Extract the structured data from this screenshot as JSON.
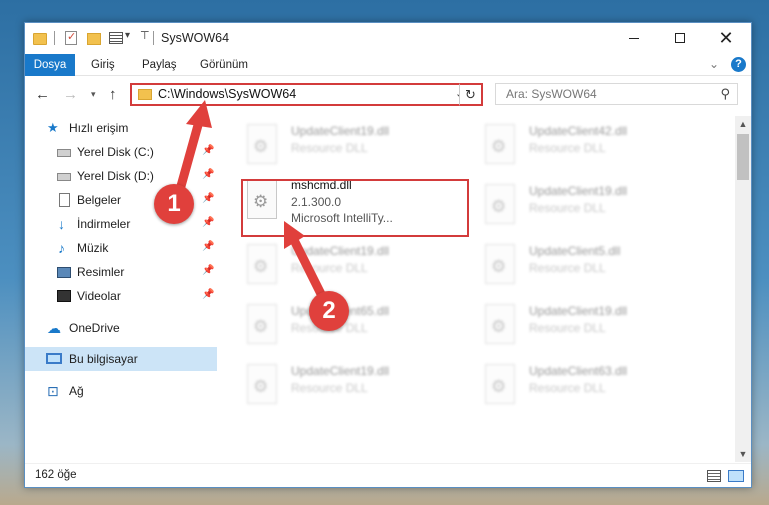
{
  "window": {
    "title": "SysWOW64",
    "controls": {
      "minimize": "minimize",
      "maximize": "maximize",
      "close": "✕"
    }
  },
  "ribbon": {
    "tabs": [
      "Dosya",
      "Giriş",
      "Paylaş",
      "Görünüm"
    ],
    "file_tab_color": "#1979ca"
  },
  "navigation": {
    "address": "C:\\Windows\\SysWOW64",
    "search_placeholder": "Ara: SysWOW64"
  },
  "sidebar": {
    "quick_access": "Hızlı erişim",
    "items": [
      {
        "label": "Yerel Disk (C:)",
        "icon": "drive-icon",
        "pinned": true
      },
      {
        "label": "Yerel Disk (D:)",
        "icon": "drive-icon",
        "pinned": true
      },
      {
        "label": "Belgeler",
        "icon": "documents-icon",
        "pinned": true
      },
      {
        "label": "İndirmeler",
        "icon": "downloads-icon",
        "pinned": true
      },
      {
        "label": "Müzik",
        "icon": "music-icon",
        "pinned": true
      },
      {
        "label": "Resimler",
        "icon": "pictures-icon",
        "pinned": true
      },
      {
        "label": "Videolar",
        "icon": "videos-icon",
        "pinned": true
      }
    ],
    "onedrive": "OneDrive",
    "this_pc": "Bu bilgisayar",
    "network": "Ağ",
    "selected": "Bu bilgisayar"
  },
  "files": {
    "highlighted": {
      "name": "mshcmd.dll",
      "version": "2.1.300.0",
      "company": "Microsoft IntelliTy..."
    },
    "left_column": [
      {
        "name": "UpdateClient19.dll",
        "type": "Resource DLL"
      },
      {
        "name": "UpdateClient19.dll",
        "type": "Resource DLL"
      },
      {
        "name": "UpdateClient65.dll",
        "type": "Resource DLL"
      },
      {
        "name": "UpdateClient19.dll",
        "type": "Resource DLL"
      }
    ],
    "right_column": [
      {
        "name": "UpdateClient42.dll",
        "type": "Resource DLL"
      },
      {
        "name": "UpdateClient19.dll",
        "type": "Resource DLL"
      },
      {
        "name": "UpdateClient5.dll",
        "type": "Resource DLL"
      },
      {
        "name": "UpdateClient19.dll",
        "type": "Resource DLL"
      },
      {
        "name": "UpdateClient63.dll",
        "type": "Resource DLL"
      }
    ]
  },
  "status": {
    "item_count": "162 öğe"
  },
  "annotations": {
    "step1": "1",
    "step2": "2",
    "color": "#e0403c"
  }
}
